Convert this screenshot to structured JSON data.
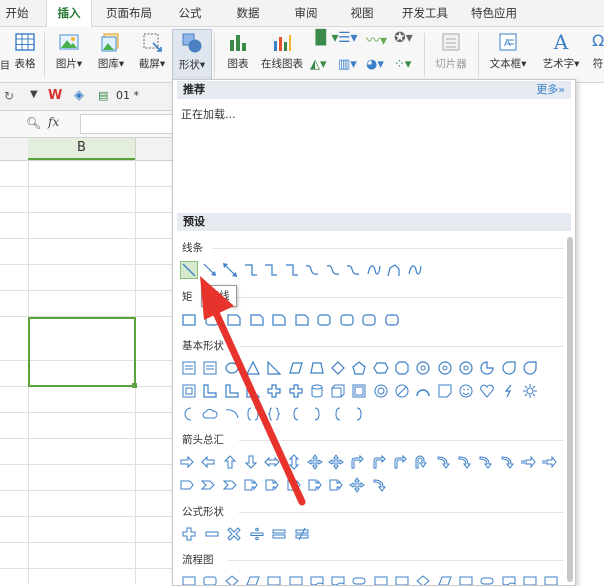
{
  "tabs": [
    "开始",
    "插入",
    "页面布局",
    "公式",
    "数据",
    "审阅",
    "视图",
    "开发工具",
    "特色应用"
  ],
  "active_tab": "插入",
  "ribbon": {
    "table": "表格",
    "picture": "图片",
    "gallery": "图库",
    "screenshot": "截屏",
    "shapes": "形状",
    "chart": "图表",
    "online_chart": "在线图表",
    "slicer": "切片器",
    "textbox": "文本框",
    "arttext": "艺术字",
    "symbol": "符"
  },
  "quickbar": {
    "filename": "01 *"
  },
  "formula": {
    "fx": "fx"
  },
  "grid": {
    "column_b": "B"
  },
  "panel": {
    "recommended_title": "推荐",
    "more": "更多»",
    "loading": "正在加载...",
    "preset_title": "预设",
    "groups": {
      "lines": "线条",
      "rect": "矩",
      "basic": "基本形状",
      "arrows": "箭头总汇",
      "formula": "公式形状",
      "flow": "流程图"
    },
    "tooltip": "直线"
  },
  "colors": {
    "accent_green": "#2a7a36",
    "arrow_red": "#e8322c",
    "selection_green": "#5aa33c"
  }
}
